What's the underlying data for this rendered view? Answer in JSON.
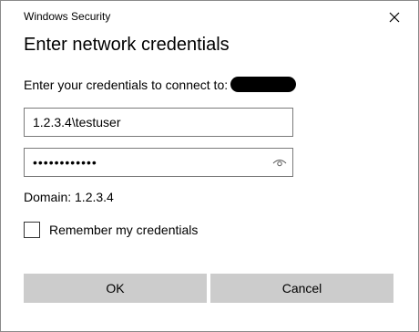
{
  "window": {
    "title": "Windows Security",
    "close_icon": "close-icon"
  },
  "dialog": {
    "heading": "Enter network credentials",
    "prompt": "Enter your credentials to connect to:",
    "username_value": "1.2.3.4\\testuser",
    "password_value": "••••••••••••",
    "reveal_icon": "eye-icon",
    "domain": "Domain: 1.2.3.4",
    "remember_label": "Remember my credentials",
    "remember_checked": false
  },
  "buttons": {
    "ok_label": "OK",
    "cancel_label": "Cancel"
  },
  "colors": {
    "button_bg": "#cccccc",
    "field_border": "#7a7a7a",
    "redaction": "#000000"
  }
}
